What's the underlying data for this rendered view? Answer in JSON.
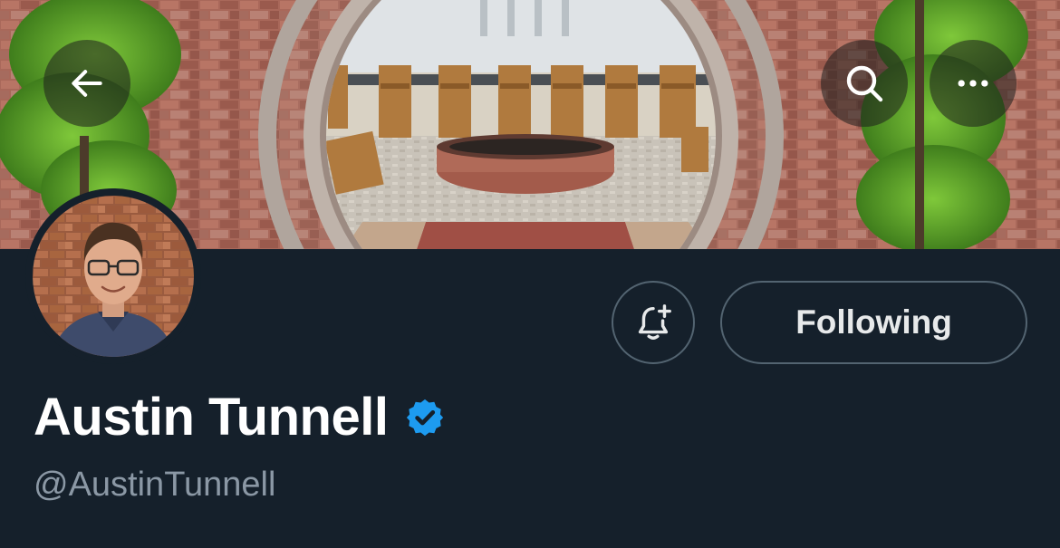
{
  "header": {
    "back_icon": "arrow-left-icon",
    "search_icon": "search-icon",
    "more_icon": "more-horizontal-icon"
  },
  "profile": {
    "display_name": "Austin Tunnell",
    "handle": "@AustinTunnell",
    "verified_icon": "verified-badge-icon"
  },
  "actions": {
    "notify_icon": "bell-plus-icon",
    "following_label": "Following"
  },
  "colors": {
    "background": "#15202b",
    "verified_blue": "#1d9bf0",
    "handle_gray": "#8b98a5",
    "button_border": "#536471"
  }
}
